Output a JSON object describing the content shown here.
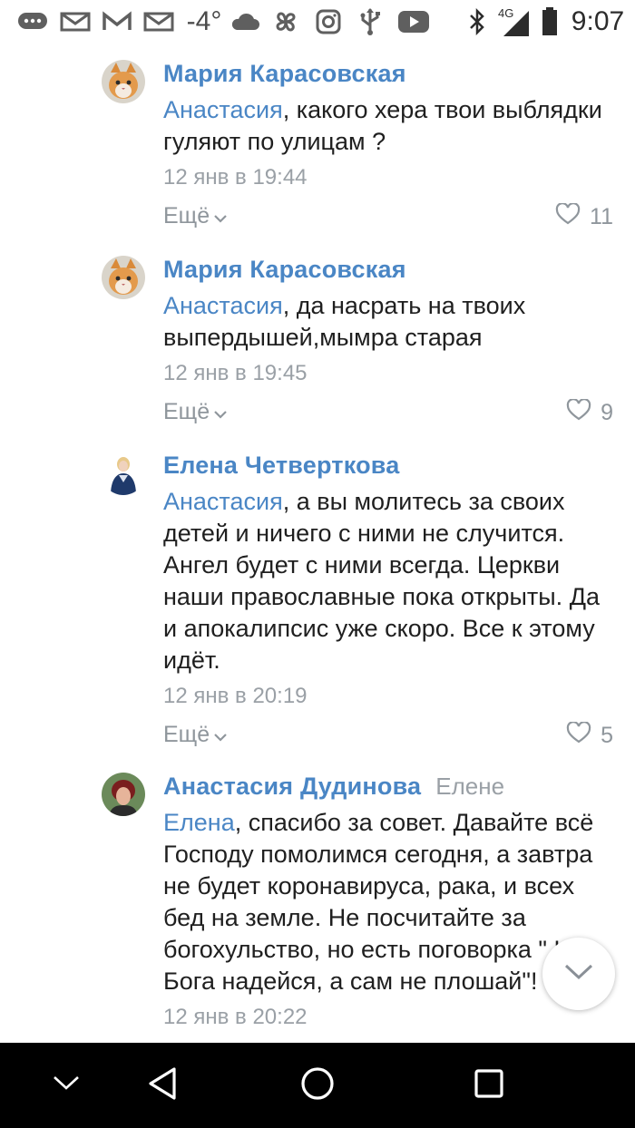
{
  "status_bar": {
    "temperature": "-4°",
    "network": "4G",
    "time": "9:07",
    "icons": [
      "chat-bubble-icon",
      "mail-icon",
      "gmail-icon",
      "mail-icon",
      "cloud-icon",
      "pinwheel-icon",
      "instagram-icon",
      "usb-icon",
      "youtube-icon",
      "bluetooth-icon",
      "signal-icon",
      "battery-icon"
    ]
  },
  "comments": [
    {
      "author": "Мария Карасовская",
      "reply_to": "",
      "mention": "Анастасия",
      "text": ", какого хера твои выблядки гуляют по улицам ?",
      "timestamp": "12 янв в 19:44",
      "more_label": "Ещё",
      "likes": "11",
      "avatar": "cat"
    },
    {
      "author": "Мария Карасовская",
      "reply_to": "",
      "mention": "Анастасия",
      "text": ", да насрать на твоих выпердышей,мымра старая",
      "timestamp": "12 янв в 19:45",
      "more_label": "Ещё",
      "likes": "9",
      "avatar": "cat"
    },
    {
      "author": "Елена Четверткова",
      "reply_to": "",
      "mention": "Анастасия",
      "text": ", а вы молитесь за своих детей и ничего с ними не случится. Ангел будет с ними всегда. Церкви наши православные пока открыты. Да и апокалипсис уже скоро. Все к этому идёт.",
      "timestamp": "12 янв в 20:19",
      "more_label": "Ещё",
      "likes": "5",
      "avatar": "woman-blue"
    },
    {
      "author": "Анастасия Дудинова",
      "reply_to": "Елене",
      "mention": "Елена",
      "text": ", спасибо за совет. Давайте всё Господу помолимся сегодня, а завтра не будет коронавируса, рака, и всех бед на земле. Не посчитайте за богохульство, но есть поговорка \" На Бога надейся, а сам не плошай\"!",
      "timestamp": "12 янв в 20:22",
      "more_label": "",
      "likes": "",
      "avatar": "woman-red"
    }
  ],
  "nav": {
    "buttons": [
      "collapse-keyboard",
      "back",
      "home",
      "recents"
    ]
  },
  "colors": {
    "link": "#4a86c5",
    "meta": "#9aa0a6",
    "nav_bg": "#000000"
  }
}
